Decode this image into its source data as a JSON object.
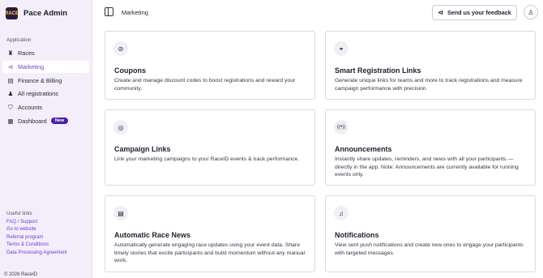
{
  "app": {
    "name": "Pace Admin",
    "logo_text": "RACE"
  },
  "sidebar": {
    "section_label": "Application",
    "items": [
      {
        "label": "Races",
        "icon": "trophy-icon",
        "glyph": "♜"
      },
      {
        "label": "Marketing",
        "icon": "megaphone-icon",
        "glyph": "⊲"
      },
      {
        "label": "Finance & Billing",
        "icon": "wallet-icon",
        "glyph": "▤"
      },
      {
        "label": "All registrations",
        "icon": "users-icon",
        "glyph": "♟"
      },
      {
        "label": "Accounts",
        "icon": "shield-icon",
        "glyph": "⛉"
      },
      {
        "label": "Dashboard",
        "icon": "grid-icon",
        "glyph": "▦",
        "badge": "New"
      }
    ],
    "useful_links_label": "Useful links",
    "useful_links": [
      "FAQ / Support",
      "Go to website",
      "Referral program",
      "Terms & Conditions",
      "Data Processing Agreement"
    ],
    "copyright": "© 2026 RaceID"
  },
  "header": {
    "title": "Marketing",
    "feedback_label": "Send us your feedback"
  },
  "cards": [
    {
      "title": "Coupons",
      "icon": "coupon-icon",
      "glyph": "⊘",
      "description": "Create and manage discount codes to boost registrations and reward your community."
    },
    {
      "title": "Smart Registration Links",
      "icon": "link-icon",
      "glyph": "🔗",
      "description": "Generate unique links for teams and more to track registrations and measure campaign performance with precision."
    },
    {
      "title": "Campaign Links",
      "icon": "target-icon",
      "glyph": "◎",
      "description": "Link your marketing campaigns to your RaceID events & track performance."
    },
    {
      "title": "Announcements",
      "icon": "broadcast-icon",
      "glyph": "((•))",
      "description": "Instantly share updates, reminders, and news with all your participants —directly in the app. Note: Announcements are currently available for running events only."
    },
    {
      "title": "Automatic Race News",
      "icon": "newspaper-icon",
      "glyph": "▤",
      "description": "Automatically generate engaging race updates using your event data. Share timely stories that excite participants and build momentum without any manual work."
    },
    {
      "title": "Notifications",
      "icon": "bell-icon",
      "glyph": "🔔",
      "description": "View sent push notifications and create new ones to engage your participants with targeted messages."
    }
  ],
  "colors": {
    "accent": "#6b3fd4",
    "sidebar_bg": "#f3eefa",
    "badge_bg": "#4b1fa8"
  }
}
